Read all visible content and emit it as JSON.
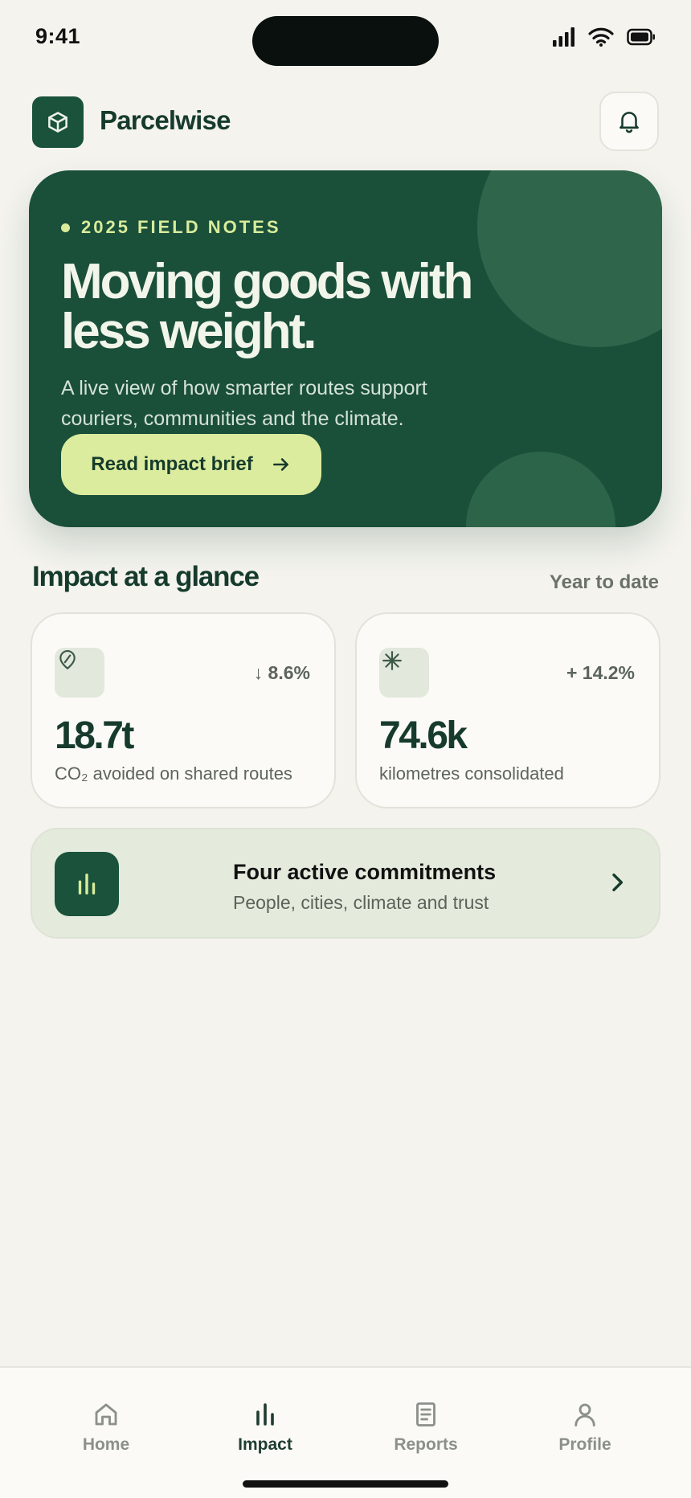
{
  "status": {
    "time": "9:41"
  },
  "header": {
    "brand": "Parcelwise"
  },
  "hero": {
    "eyebrow": "2025 FIELD NOTES",
    "title_line1": "Moving goods with",
    "title_line2": "less weight.",
    "subtitle_line1": "A live view of how smarter routes support",
    "subtitle_line2": "couriers, communities and the climate.",
    "cta_label": "Read impact brief"
  },
  "impact": {
    "title": "Impact at a glance",
    "period": "Year to date",
    "cards": [
      {
        "icon": "leaf-icon",
        "delta": "↓ 8.6%",
        "value": "18.7t",
        "caption": "CO₂ avoided on shared routes"
      },
      {
        "icon": "sparkle-icon",
        "delta": "+ 14.2%",
        "value": "74.6k",
        "caption": "kilometres consolidated"
      }
    ]
  },
  "commitments": {
    "title": "Four active commitments",
    "subtitle": "People, cities, climate and trust"
  },
  "nav": {
    "items": [
      {
        "label": "Home",
        "icon": "home-icon",
        "active": false
      },
      {
        "label": "Impact",
        "icon": "bar-chart-icon",
        "active": true
      },
      {
        "label": "Reports",
        "icon": "document-icon",
        "active": false
      },
      {
        "label": "Profile",
        "icon": "user-icon",
        "active": false
      }
    ]
  },
  "colors": {
    "brand_green": "#1a4f3a",
    "accent_lime": "#dcec9e",
    "background": "#f4f3ee"
  }
}
